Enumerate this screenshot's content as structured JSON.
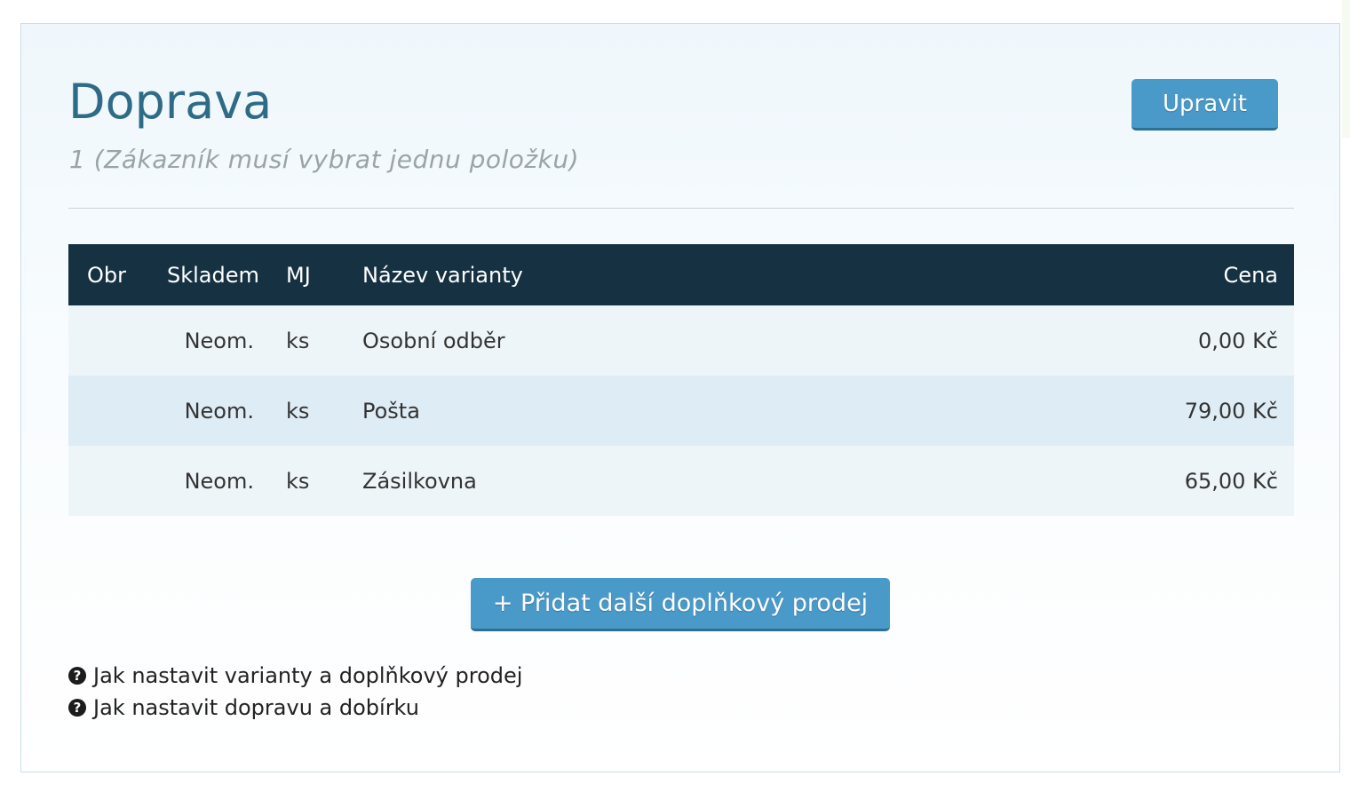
{
  "panel": {
    "title": "Doprava",
    "subtitle": "1 (Zákazník musí vybrat jednu položku)",
    "edit_label": "Upravit"
  },
  "table": {
    "columns": {
      "obr": "Obr",
      "skladem": "Skladem",
      "mj": "MJ",
      "nazev": "Název varianty",
      "cena": "Cena"
    },
    "rows": [
      {
        "obr": "",
        "skladem": "Neom.",
        "mj": "ks",
        "nazev": "Osobní odběr",
        "cena": "0,00 Kč"
      },
      {
        "obr": "",
        "skladem": "Neom.",
        "mj": "ks",
        "nazev": "Pošta",
        "cena": "79,00 Kč"
      },
      {
        "obr": "",
        "skladem": "Neom.",
        "mj": "ks",
        "nazev": "Zásilkovna",
        "cena": "65,00 Kč"
      }
    ]
  },
  "add_button_label": "+ Přidat další doplňkový prodej",
  "help_links": [
    {
      "icon": "question-circle-icon",
      "label": "Jak nastavit varianty a doplňkový prodej"
    },
    {
      "icon": "question-circle-icon",
      "label": "Jak nastavit dopravu a dobírku"
    }
  ],
  "colors": {
    "title": "#2e6b86",
    "button": "#4a9ac9",
    "table_header": "#163142"
  }
}
